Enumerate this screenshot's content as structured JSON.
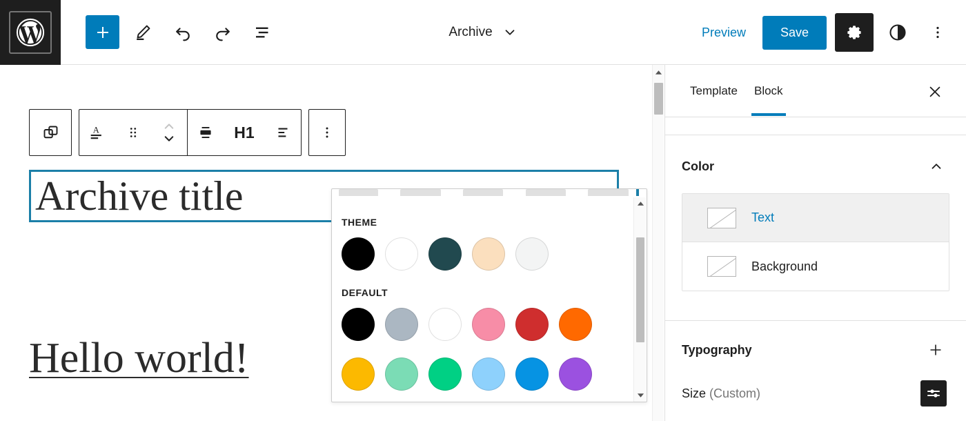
{
  "header": {
    "logo_icon": "wordpress-logo-icon",
    "add_block_label": "+",
    "add_block_icon": "plus-icon",
    "edit_icon": "pencil-icon",
    "undo_icon": "undo-arrow-icon",
    "redo_icon": "redo-arrow-icon",
    "list_view_icon": "list-view-icon",
    "document_title": "Archive",
    "document_title_chevron": "chevron-down-icon",
    "preview_label": "Preview",
    "save_label": "Save",
    "settings_icon": "gear-icon",
    "styles_icon": "contrast-half-circle-icon",
    "options_icon": "vertical-ellipsis-icon"
  },
  "block_toolbar": {
    "select_parent_icon": "select-parent-blocks-icon",
    "transform_icon": "paragraph-transform-icon",
    "drag_icon": "drag-handle-dots-icon",
    "move_updown_icon": "move-up-down-chevrons-icon",
    "align_icon": "align-block-icon",
    "heading_level_label": "H1",
    "text_align_icon": "text-align-left-icon",
    "more_options_icon": "vertical-ellipsis-icon"
  },
  "canvas": {
    "archive_title": "Archive title",
    "post_title": "Hello world!",
    "selection_color": "#1b7fa8"
  },
  "color_popover": {
    "theme_label": "THEME",
    "default_label": "DEFAULT",
    "theme_colors": [
      {
        "name": "Black",
        "hex": "#000000"
      },
      {
        "name": "White",
        "hex": "#ffffff"
      },
      {
        "name": "Dark Teal",
        "hex": "#21494f"
      },
      {
        "name": "Peach",
        "hex": "#fbdfbe"
      },
      {
        "name": "Off White",
        "hex": "#f3f4f4"
      }
    ],
    "default_colors": [
      {
        "name": "Black",
        "hex": "#000000"
      },
      {
        "name": "Cyan Bluish Gray",
        "hex": "#abb7c2"
      },
      {
        "name": "White",
        "hex": "#ffffff"
      },
      {
        "name": "Pale Pink",
        "hex": "#f78da7"
      },
      {
        "name": "Vivid Red",
        "hex": "#cf2e2e"
      },
      {
        "name": "Luminous Vivid Orange",
        "hex": "#ff6900"
      },
      {
        "name": "Luminous Vivid Amber",
        "hex": "#fcb900"
      },
      {
        "name": "Light Green Cyan",
        "hex": "#7bdcb5"
      },
      {
        "name": "Vivid Green Cyan",
        "hex": "#00d084"
      },
      {
        "name": "Pale Cyan Blue",
        "hex": "#8ed1fc"
      },
      {
        "name": "Vivid Cyan Blue",
        "hex": "#0693e3"
      },
      {
        "name": "Vivid Purple",
        "hex": "#9b51e0"
      }
    ],
    "scroll_up_icon": "scroll-up-arrow-icon",
    "scroll_down_icon": "scroll-down-arrow-icon"
  },
  "sidebar": {
    "tabs": [
      {
        "label": "Template",
        "active": false
      },
      {
        "label": "Block",
        "active": true
      }
    ],
    "close_icon": "close-x-icon",
    "color_section": {
      "title": "Color",
      "collapse_icon": "chevron-up-icon",
      "rows": [
        {
          "label": "Text",
          "selected": true
        },
        {
          "label": "Background",
          "selected": false
        }
      ]
    },
    "typography_section": {
      "title": "Typography",
      "add_icon": "plus-icon",
      "size_label": "Size",
      "size_value": "(Custom)",
      "size_settings_icon": "sliders-settings-icon"
    },
    "accent_color": "#007cba"
  },
  "scrollbars": {
    "canvas_up_icon": "scroll-up-arrow-icon"
  }
}
